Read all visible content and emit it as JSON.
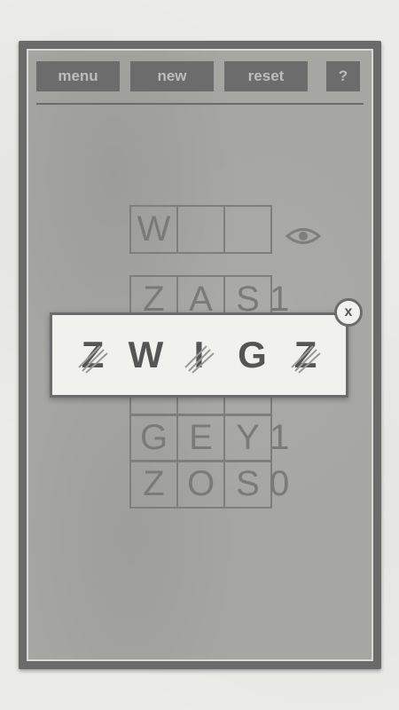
{
  "toolbar": {
    "menu_label": "menu",
    "new_label": "new",
    "reset_label": "reset",
    "help_label": "?"
  },
  "guess_row": {
    "letters": [
      "W",
      "",
      ""
    ]
  },
  "rows": [
    {
      "letters": [
        "Z",
        "A",
        "S"
      ],
      "score": "1"
    },
    {
      "letters": [
        "",
        "",
        ""
      ],
      "score": ""
    },
    {
      "letters": [
        "",
        "",
        ""
      ],
      "score": ""
    },
    {
      "letters": [
        "G",
        "E",
        "Y"
      ],
      "score": "1"
    },
    {
      "letters": [
        "Z",
        "O",
        "S"
      ],
      "score": "0"
    }
  ],
  "popup": {
    "word_letters": [
      "Z",
      "W",
      "I",
      "G",
      "Z"
    ],
    "close_label": "x"
  },
  "colors": {
    "frame": "#6a6a6a",
    "board": "#a6a6a3",
    "button": "#6c6c6c",
    "button_text": "#bdbdbd",
    "popup_bg": "#f1f1ee"
  }
}
